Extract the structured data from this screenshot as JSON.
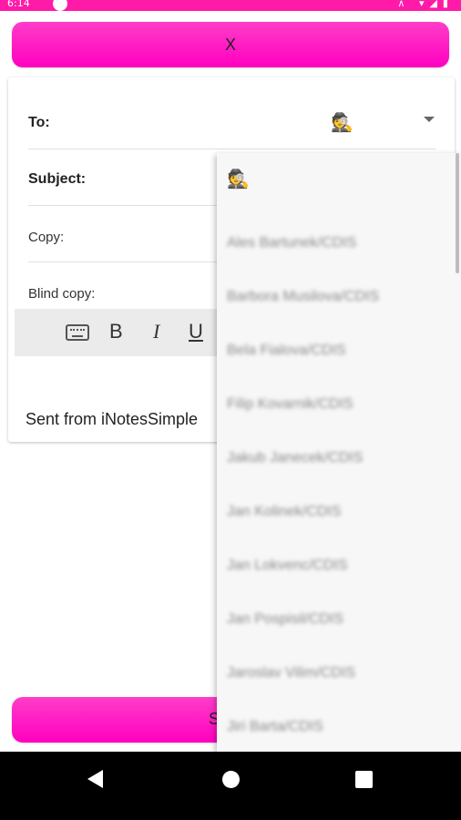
{
  "status_bar": {
    "time": "6:14",
    "icons_text": "⊼ ▾◢▮"
  },
  "top_button": {
    "label": "X"
  },
  "form": {
    "to_label": "To:",
    "subject_label": "Subject:",
    "copy_label": "Copy:",
    "blind_copy_label": "Blind copy:",
    "to_icon": "🕵"
  },
  "toolbar": {
    "keyboard_icon": "keyboard-icon",
    "bold": "B",
    "italic": "I",
    "underline": "U"
  },
  "signature": "Sent from iNotesSimple",
  "bottom_button": {
    "label": "S"
  },
  "dropdown": {
    "first_icon": "🕵",
    "items": [
      "Ales Bartunek/CDIS",
      "Barbora Musilova/CDIS",
      "Bela Fialova/CDIS",
      "Filip Kovarnik/CDIS",
      "Jakub Janecek/CDIS",
      "Jan Kolinek/CDIS",
      "Jan Lokvenc/CDIS",
      "Jan Pospisil/CDIS",
      "Jaroslav Vilim/CDIS",
      "Jiri Barta/CDIS"
    ]
  }
}
